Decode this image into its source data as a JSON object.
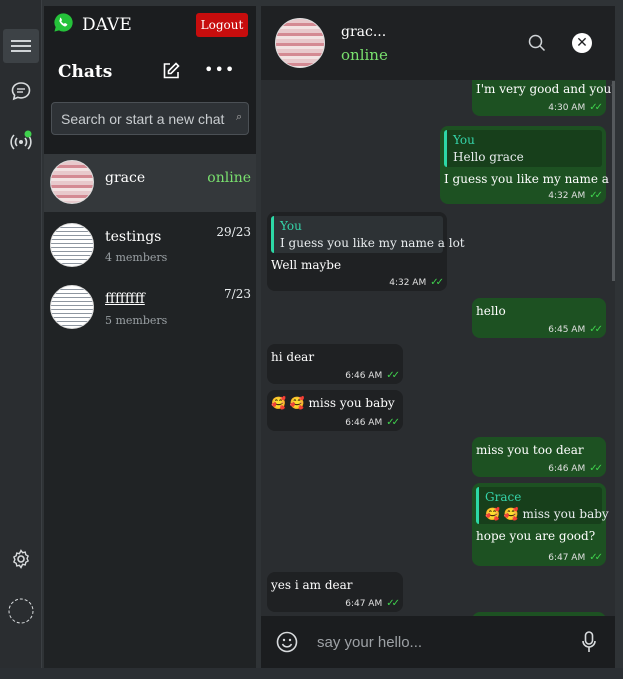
{
  "app": {
    "user_name": "DAVE",
    "logout_label": "Logout",
    "chats_title": "Chats",
    "more_label": "•••",
    "search_placeholder": "Search or start a new chat",
    "search_glyph": "⌕"
  },
  "chat_list": [
    {
      "name": "grace",
      "status": "online",
      "active": true
    },
    {
      "name": "testings",
      "subtitle": "4 members",
      "count": "29/23"
    },
    {
      "name": "ffffffff",
      "subtitle": "5 members",
      "count": "7/23"
    }
  ],
  "conversation": {
    "name": "grac...",
    "status": "online",
    "close_glyph": "✕",
    "input_placeholder": "say your hello..."
  },
  "messages": [
    {
      "dir": "out",
      "text": "I'm very good and you?",
      "time": "4:30 AM"
    },
    {
      "dir": "out",
      "quote_name": "You",
      "quote_text": "Hello grace",
      "text": "I guess you like my name a lot",
      "time": "4:32 AM"
    },
    {
      "dir": "in",
      "quote_name": "You",
      "quote_text": "I guess you like my name a lot",
      "text": "Well maybe",
      "time": "4:32 AM"
    },
    {
      "dir": "out",
      "text": "hello",
      "time": "6:45 AM"
    },
    {
      "dir": "in",
      "text": "hi dear",
      "time": "6:46 AM"
    },
    {
      "dir": "in",
      "text": "🥰 🥰 miss you baby",
      "time": "6:46 AM"
    },
    {
      "dir": "out",
      "text": "miss you too dear",
      "time": "6:46 AM"
    },
    {
      "dir": "out",
      "quote_name": "Grace",
      "quote_text": "🥰 🥰 miss you baby",
      "text": "hope you are good?",
      "time": "6:47 AM"
    },
    {
      "dir": "in",
      "text": "yes i am dear",
      "time": "6:47 AM"
    }
  ],
  "read_glyph": "✓✓",
  "icons": {
    "menu": "hamburger-menu-icon",
    "chat": "chat-bubble-icon",
    "status": "broadcast-icon",
    "settings": "gear-icon",
    "profile": "profile-circle-icon",
    "brand": "whatsapp-icon",
    "compose": "compose-icon",
    "search": "search-icon",
    "close": "close-icon",
    "emoji": "emoji-icon",
    "mic": "microphone-icon"
  },
  "colors": {
    "outgoing_bubble": "#1d5122",
    "incoming_bubble": "#1f2123",
    "online": "#79e06e",
    "logout": "#c70d0d",
    "quote_accent": "#2dd8a6",
    "read_ticks": "#3fd14d"
  }
}
